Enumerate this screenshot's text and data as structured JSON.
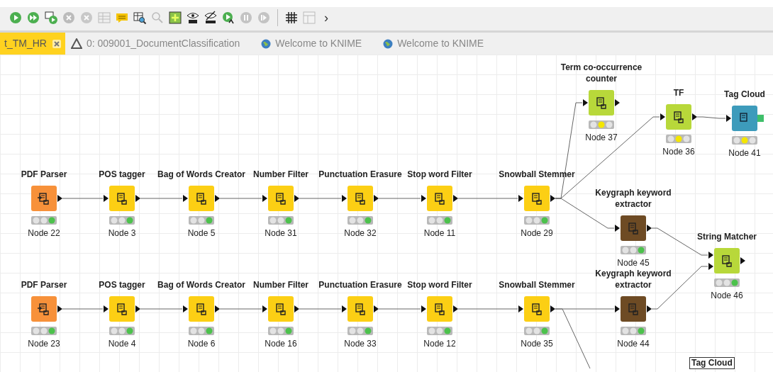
{
  "toolbar": {
    "items": [
      {
        "kind": "execute",
        "disabled": false
      },
      {
        "kind": "execute-all",
        "disabled": false
      },
      {
        "kind": "execute-open",
        "disabled": false
      },
      {
        "kind": "cancel",
        "disabled": true
      },
      {
        "kind": "cancel-all",
        "disabled": true
      },
      {
        "kind": "reset",
        "disabled": true
      },
      {
        "kind": "annotation",
        "disabled": false
      },
      {
        "kind": "open-view",
        "disabled": false
      },
      {
        "kind": "search",
        "disabled": true
      },
      {
        "kind": "metanode",
        "disabled": false
      },
      {
        "kind": "show-ids",
        "disabled": false
      },
      {
        "kind": "hide-ids",
        "disabled": false
      },
      {
        "kind": "step",
        "disabled": false
      },
      {
        "kind": "pause",
        "disabled": true
      },
      {
        "kind": "resume",
        "disabled": true
      },
      {
        "kind": "separator"
      },
      {
        "kind": "grid",
        "disabled": false
      },
      {
        "kind": "layout",
        "disabled": true
      }
    ],
    "overflow": "›"
  },
  "tabs": [
    {
      "label": "t_TM_HR",
      "selected": true,
      "kind": "workflow"
    },
    {
      "label": "0: 009001_DocumentClassification",
      "selected": false,
      "kind": "warning"
    },
    {
      "label": "Welcome to KNIME",
      "selected": false,
      "kind": "web"
    },
    {
      "label": "Welcome to KNIME",
      "selected": false,
      "kind": "web"
    }
  ],
  "nodes": [
    {
      "label": "PDF Parser",
      "name": "Node 22",
      "kind": "source",
      "executed": true
    },
    {
      "label": "POS tagger",
      "name": "Node 3",
      "kind": "manipulator",
      "executed": true
    },
    {
      "label": "Bag of Words Creator",
      "name": "Node 5",
      "kind": "manipulator",
      "executed": true
    },
    {
      "label": "Number Filter",
      "name": "Node 31",
      "kind": "manipulator",
      "executed": true
    },
    {
      "label": "Punctuation Erasure",
      "name": "Node 32",
      "kind": "manipulator",
      "executed": true
    },
    {
      "label": "Stop word Filter",
      "name": "Node 11",
      "kind": "manipulator",
      "executed": true
    },
    {
      "label": "Snowball Stemmer",
      "name": "Node 29",
      "kind": "manipulator",
      "executed": true
    },
    {
      "label": "PDF Parser",
      "name": "Node 23",
      "kind": "source",
      "executed": true
    },
    {
      "label": "POS tagger",
      "name": "Node 4",
      "kind": "manipulator",
      "executed": true
    },
    {
      "label": "Bag of Words Creator",
      "name": "Node 6",
      "kind": "manipulator",
      "executed": true
    },
    {
      "label": "Number Filter",
      "name": "Node 16",
      "kind": "manipulator",
      "executed": true
    },
    {
      "label": "Punctuation Erasure",
      "name": "Node 33",
      "kind": "manipulator",
      "executed": true
    },
    {
      "label": "Stop word Filter",
      "name": "Node 12",
      "kind": "manipulator",
      "executed": true
    },
    {
      "label": "Snowball Stemmer",
      "name": "Node 35",
      "kind": "manipulator",
      "executed": true
    },
    {
      "label": "Term co-occurrence counter",
      "name": "Node 37",
      "kind": "other",
      "executed": false
    },
    {
      "label": "TF",
      "name": "Node 36",
      "kind": "other",
      "executed": false
    },
    {
      "label": "Tag Cloud",
      "name": "Node 41",
      "kind": "visualizer",
      "executed": false
    },
    {
      "label": "Keygraph keyword extractor",
      "name": "Node 45",
      "kind": "miner",
      "executed": true
    },
    {
      "label": "Keygraph keyword extractor",
      "name": "Node 44",
      "kind": "miner",
      "executed": true
    },
    {
      "label": "String Matcher",
      "name": "Node 46",
      "kind": "other",
      "executed": true
    }
  ],
  "cut_label": "Tag Cloud"
}
